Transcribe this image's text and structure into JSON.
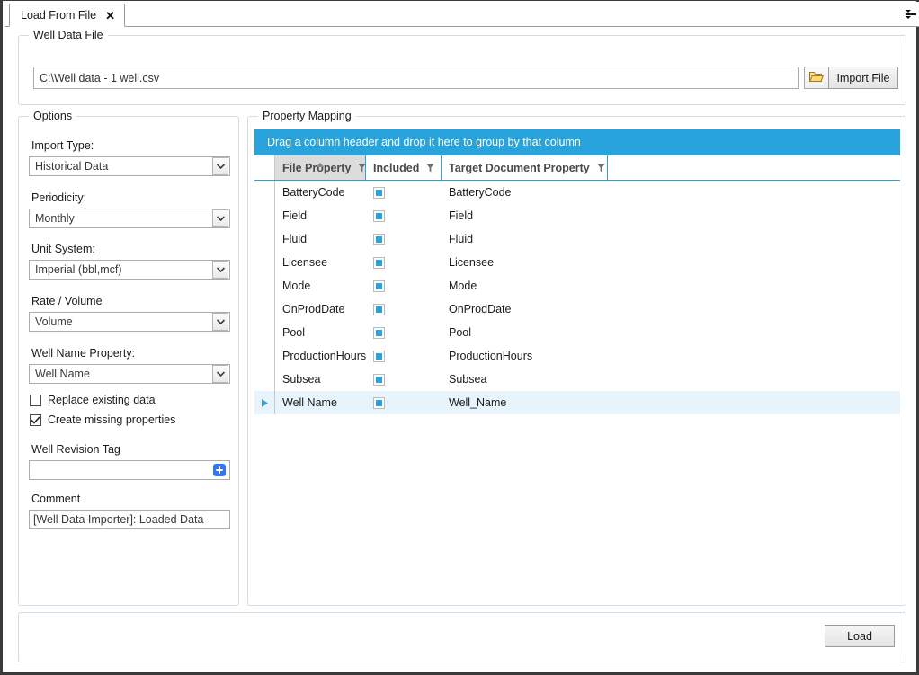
{
  "window": {
    "tab": {
      "label": "Load From File",
      "close_icon": "close-icon"
    },
    "overflow_icon": "tab-overflow-icon"
  },
  "well_data_file": {
    "group_title": "Well Data File",
    "path_value": "C:\\Well data - 1 well.csv",
    "path_placeholder": "",
    "browse_icon": "open-folder-icon",
    "import_button": "Import File"
  },
  "options": {
    "group_title": "Options",
    "fields": [
      {
        "label": "Import Type:",
        "value": "Historical Data"
      },
      {
        "label": "Periodicity:",
        "value": "Monthly"
      },
      {
        "label": "Unit System:",
        "value": "Imperial (bbl,mcf)"
      },
      {
        "label": "Rate / Volume",
        "value": "Volume"
      },
      {
        "label": "Well Name Property:",
        "value": "Well Name"
      }
    ],
    "checkboxes": [
      {
        "label": "Replace existing data",
        "checked": false
      },
      {
        "label": "Create missing properties",
        "checked": true
      }
    ],
    "well_revision_tag": {
      "label": "Well Revision Tag",
      "value": "",
      "add_icon": "add-plus-icon"
    },
    "comment": {
      "label": "Comment",
      "value": "[Well Data Importer]: Loaded Data"
    }
  },
  "property_mapping": {
    "group_title": "Property Mapping",
    "group_panel_text": "Drag a column header and drop it here to group by that column",
    "columns": [
      {
        "label": "File Property",
        "sorted": "asc",
        "filter_icon": "filter-funnel-icon"
      },
      {
        "label": "Included",
        "sorted": "",
        "filter_icon": "filter-funnel-icon"
      },
      {
        "label": "Target Document Property",
        "sorted": "",
        "filter_icon": "filter-funnel-icon"
      }
    ],
    "rows": [
      {
        "file_property": "BatteryCode",
        "included": "indeterminate",
        "target_property": "BatteryCode",
        "selected": false
      },
      {
        "file_property": "Field",
        "included": "indeterminate",
        "target_property": "Field",
        "selected": false
      },
      {
        "file_property": "Fluid",
        "included": "indeterminate",
        "target_property": "Fluid",
        "selected": false
      },
      {
        "file_property": "Licensee",
        "included": "indeterminate",
        "target_property": "Licensee",
        "selected": false
      },
      {
        "file_property": "Mode",
        "included": "indeterminate",
        "target_property": "Mode",
        "selected": false
      },
      {
        "file_property": "OnProdDate",
        "included": "indeterminate",
        "target_property": "OnProdDate",
        "selected": false
      },
      {
        "file_property": "Pool",
        "included": "indeterminate",
        "target_property": "Pool",
        "selected": false
      },
      {
        "file_property": "ProductionHours",
        "included": "indeterminate",
        "target_property": "ProductionHours",
        "selected": false
      },
      {
        "file_property": "Subsea",
        "included": "indeterminate",
        "target_property": "Subsea",
        "selected": false
      },
      {
        "file_property": "Well Name",
        "included": "indeterminate",
        "target_property": "Well_Name",
        "selected": true
      }
    ]
  },
  "footer": {
    "load_button": "Load"
  },
  "colors": {
    "accent_blue": "#29a3dc",
    "selected_row": "#e8f4fb",
    "add_icon_blue": "#2f76f0",
    "group_border": "#d2dce4"
  }
}
